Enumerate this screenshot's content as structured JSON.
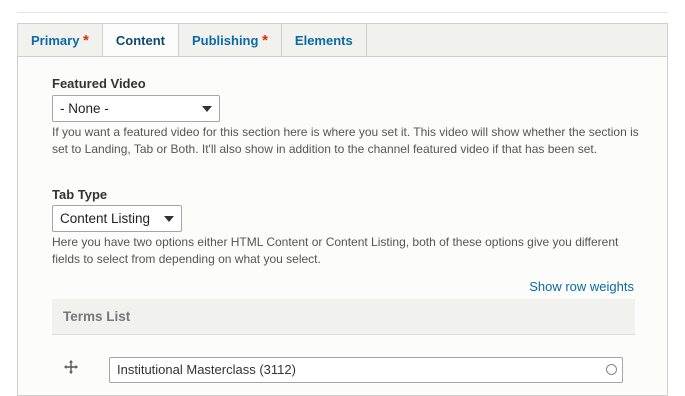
{
  "tabs": [
    {
      "label": "Primary",
      "required": "*"
    },
    {
      "label": "Content"
    },
    {
      "label": "Publishing",
      "required": "*"
    },
    {
      "label": "Elements"
    }
  ],
  "featured_video": {
    "label": "Featured Video",
    "value": "- None -",
    "description": "If you want a featured video for this section here is where you set it. This video will show whether the section is set to Landing, Tab or Both. It'll also show in addition to the channel featured video if that has been set."
  },
  "tab_type": {
    "label": "Tab Type",
    "value": "Content Listing",
    "description": "Here you have two options either HTML Content or Content Listing, both of these options give you different fields to select from depending on what you select."
  },
  "row_weights_link": "Show row weights",
  "terms_list": {
    "header": "Terms List",
    "items": [
      {
        "value": "Institutional Masterclass (3112)"
      }
    ]
  },
  "colors": {
    "link": "#0b6aa6",
    "required": "#e32700",
    "tab_bar": "#f1f1ee"
  }
}
